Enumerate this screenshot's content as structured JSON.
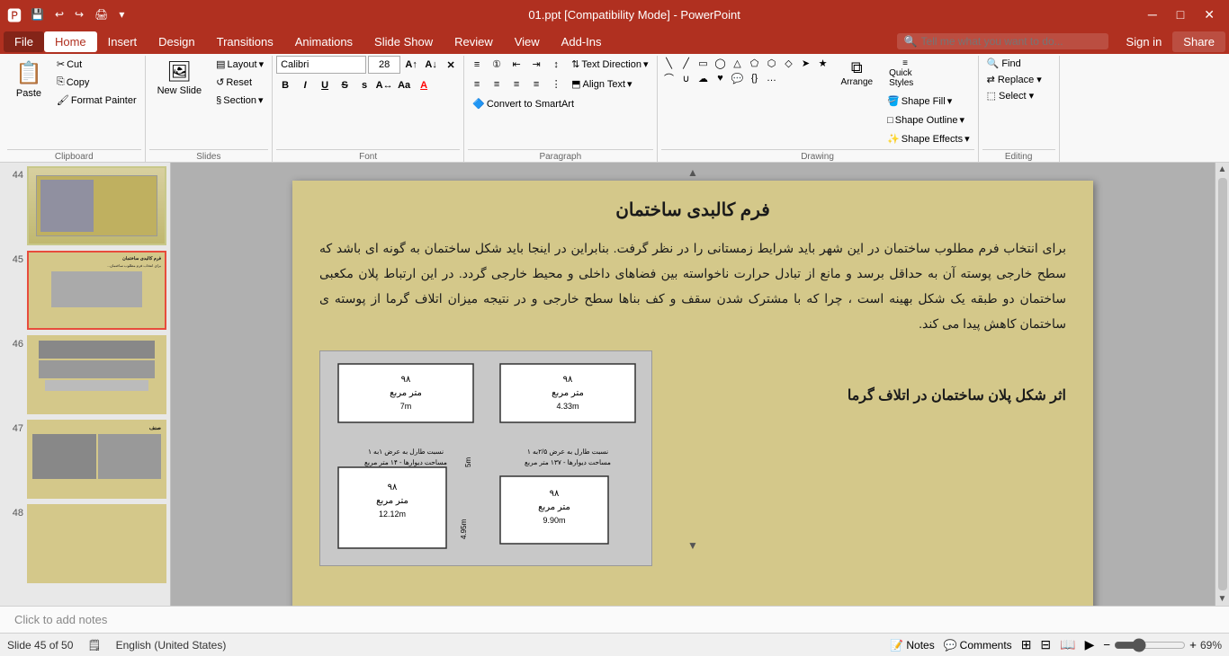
{
  "titleBar": {
    "title": "01.ppt [Compatibility Mode] - PowerPoint",
    "minimizeIcon": "─",
    "maximizeIcon": "□",
    "closeIcon": "✕",
    "quickAccess": [
      "💾",
      "↩",
      "↪",
      "🖨"
    ]
  },
  "menuBar": {
    "items": [
      "File",
      "Home",
      "Insert",
      "Design",
      "Transitions",
      "Animations",
      "Slide Show",
      "Review",
      "View",
      "Add-Ins"
    ],
    "activeIndex": 1,
    "searchPlaceholder": "Tell me what you want to do...",
    "signIn": "Sign in",
    "share": "Share"
  },
  "ribbon": {
    "clipboard": {
      "label": "Clipboard",
      "paste": "Paste",
      "cut": "Cut",
      "copy": "Copy",
      "formatPainter": "Format Painter"
    },
    "slides": {
      "label": "Slides",
      "newSlide": "New Slide",
      "layout": "Layout",
      "reset": "Reset",
      "section": "Section"
    },
    "font": {
      "label": "Font",
      "fontName": "Calibri",
      "fontSize": "28",
      "bold": "B",
      "italic": "I",
      "underline": "U",
      "strikethrough": "S",
      "shadow": "s",
      "charSpacing": "A↔",
      "caseChange": "Aa",
      "fontColor": "A",
      "increaseSize": "A↑",
      "decreaseSize": "A↓",
      "clearFormat": "✕A"
    },
    "paragraph": {
      "label": "Paragraph",
      "bulletList": "≡",
      "numberedList": "1≡",
      "decreaseIndent": "←≡",
      "increaseIndent": "→≡",
      "textDirection": "Text Direction",
      "alignText": "Align Text",
      "convertToSmartArt": "Convert to SmartArt",
      "alignLeft": "≡",
      "alignCenter": "≡",
      "alignRight": "≡",
      "justify": "≡",
      "columns": "⋮≡",
      "lineSpacing": "↕"
    },
    "drawing": {
      "label": "Drawing",
      "shapes": [
        "▭",
        "◯",
        "△",
        "⬠",
        "⬡",
        "⬟",
        "⬤",
        "⬦",
        "➤",
        "✦",
        "⌒",
        "⌓",
        "⌔",
        "⌕",
        "⌖",
        "⌗",
        "⌘",
        "⌙",
        "⌚",
        "⌛"
      ],
      "arrange": "Arrange",
      "quickStyles": "Quick Styles",
      "shapeFill": "Shape Fill",
      "shapeOutline": "Shape Outline",
      "shapeEffects": "Shape Effects"
    },
    "editing": {
      "label": "Editing",
      "find": "Find",
      "replace": "Replace",
      "select": "Select"
    }
  },
  "slides": [
    {
      "number": "44",
      "star": "★",
      "active": false
    },
    {
      "number": "45",
      "star": "★",
      "active": true
    },
    {
      "number": "46",
      "star": "★",
      "active": false
    },
    {
      "number": "47",
      "star": "★",
      "active": false
    },
    {
      "number": "48",
      "star": "★",
      "active": false
    }
  ],
  "currentSlide": {
    "title": "فرم کالبدی ساختمان",
    "body": "برای انتخاب فرم مطلوب ساختمان در این شهر باید شرایط زمستانی را در نظر گرفت. بنابراین در اینجا باید شکل ساختمان به گونه ای باشد که سطح خارجی پوسته آن به حداقل برسد و مانع از تبادل حرارت ناخواسته بین فضاهای داخلی و محیط خارجی گردد. در این ارتباط پلان مکعبی ساختمان دو طبقه یک شکل بهینه است ، چرا که با مشترک شدن سقف و کف بناها سطح خارجی و در نتیجه میزان اتلاف گرما از پوسته ی ساختمان کاهش پیدا می کند.",
    "imageCaption": "اثر شکل پلان ساختمان در اتلاف گرما",
    "diagramAlt": "Building plan heat loss diagram"
  },
  "notes": {
    "placeholder": "Click to add notes",
    "label": "Notes"
  },
  "statusBar": {
    "slideInfo": "Slide 45 of 50",
    "language": "English (United States)",
    "notes": "Notes",
    "comments": "Comments",
    "zoom": "69%",
    "zoomValue": 69
  }
}
